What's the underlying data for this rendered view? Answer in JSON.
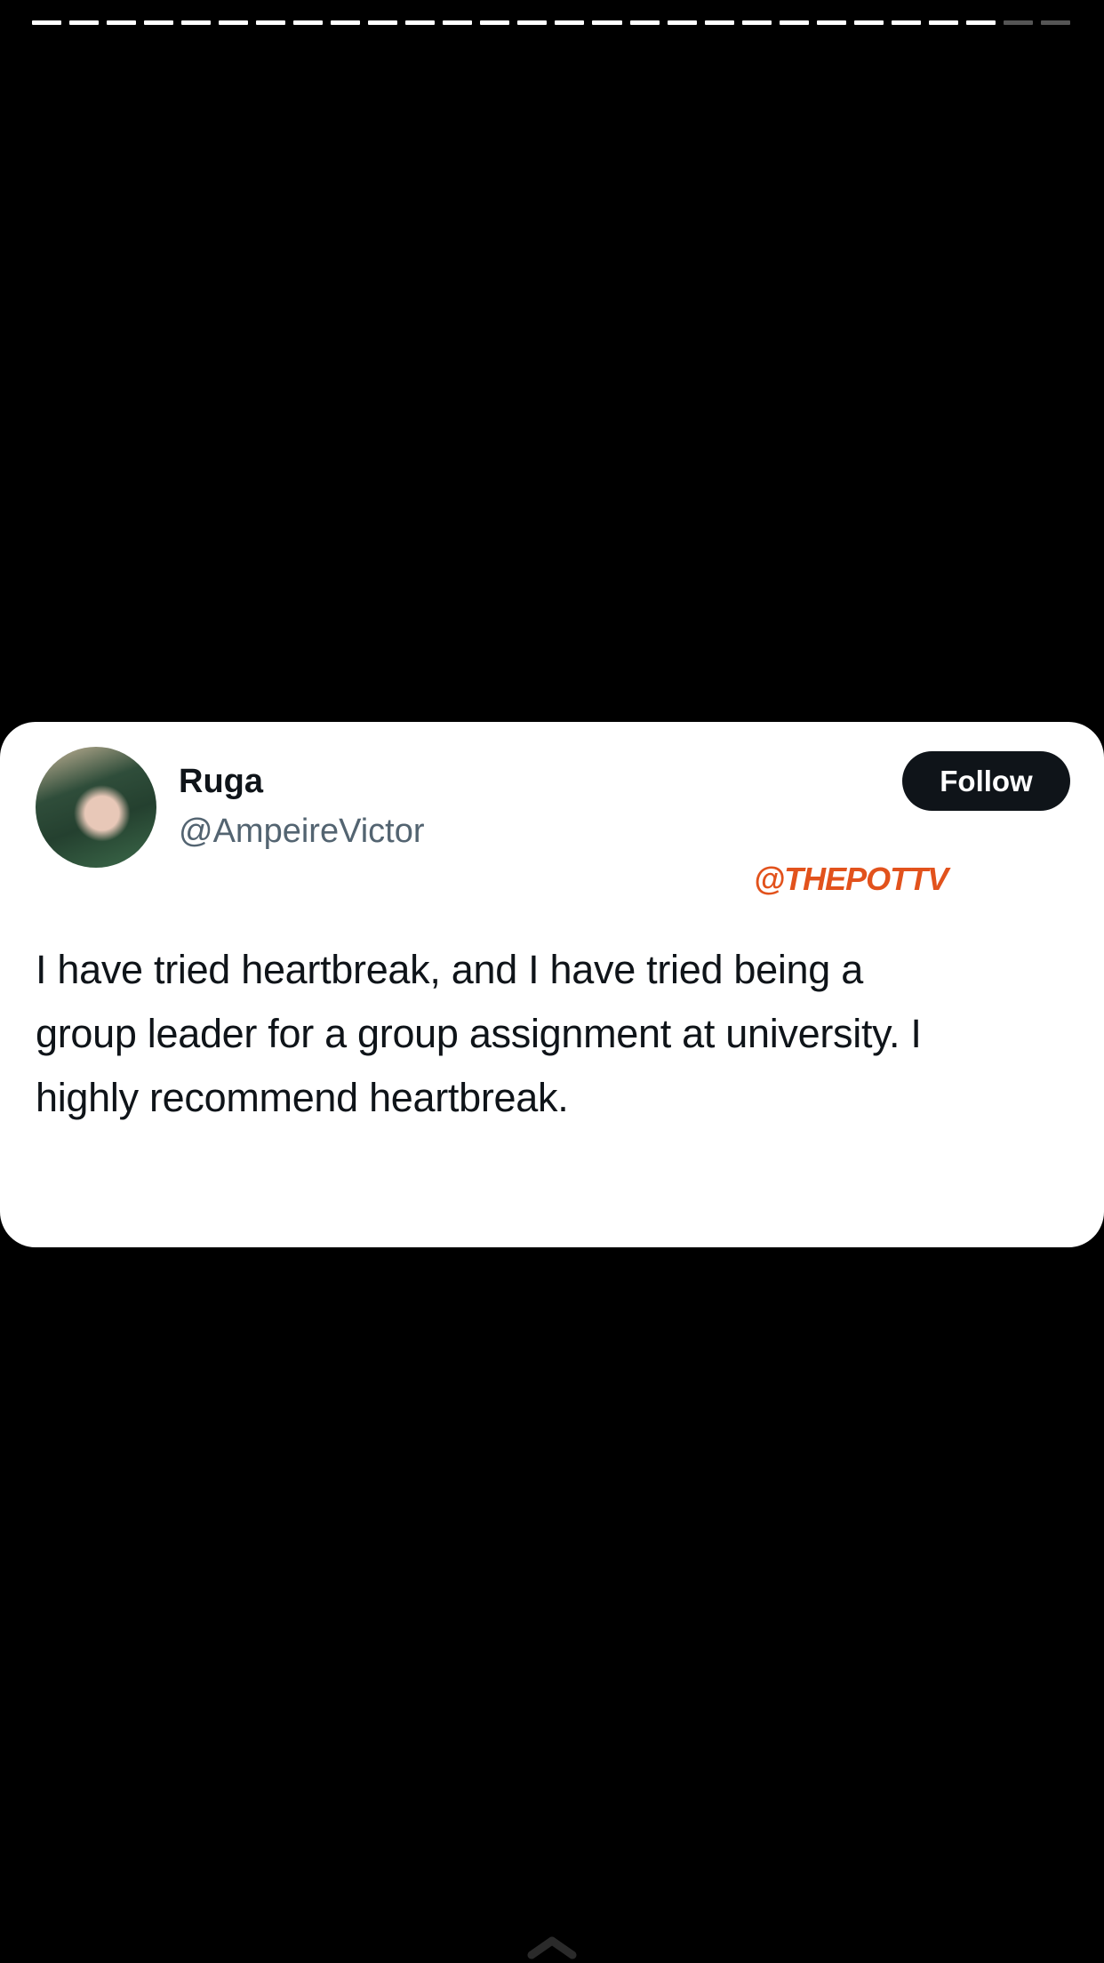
{
  "story_progress": {
    "total_segments": 28,
    "completed_segments": 26
  },
  "tweet": {
    "display_name": "Ruga",
    "handle": "@AmpeireVictor",
    "follow_label": "Follow",
    "watermark": "@THEPOTTV",
    "text_lines": [
      "I have tried heartbreak, and I have tried being a",
      "group leader for a group assignment at university. I",
      "highly recommend heartbreak."
    ]
  },
  "icons": {
    "bottom": "chevron-up-icon"
  },
  "colors": {
    "background": "#000000",
    "card": "#ffffff",
    "follow_button": "#0f1419",
    "watermark": "#e2521c",
    "handle": "#536471"
  }
}
